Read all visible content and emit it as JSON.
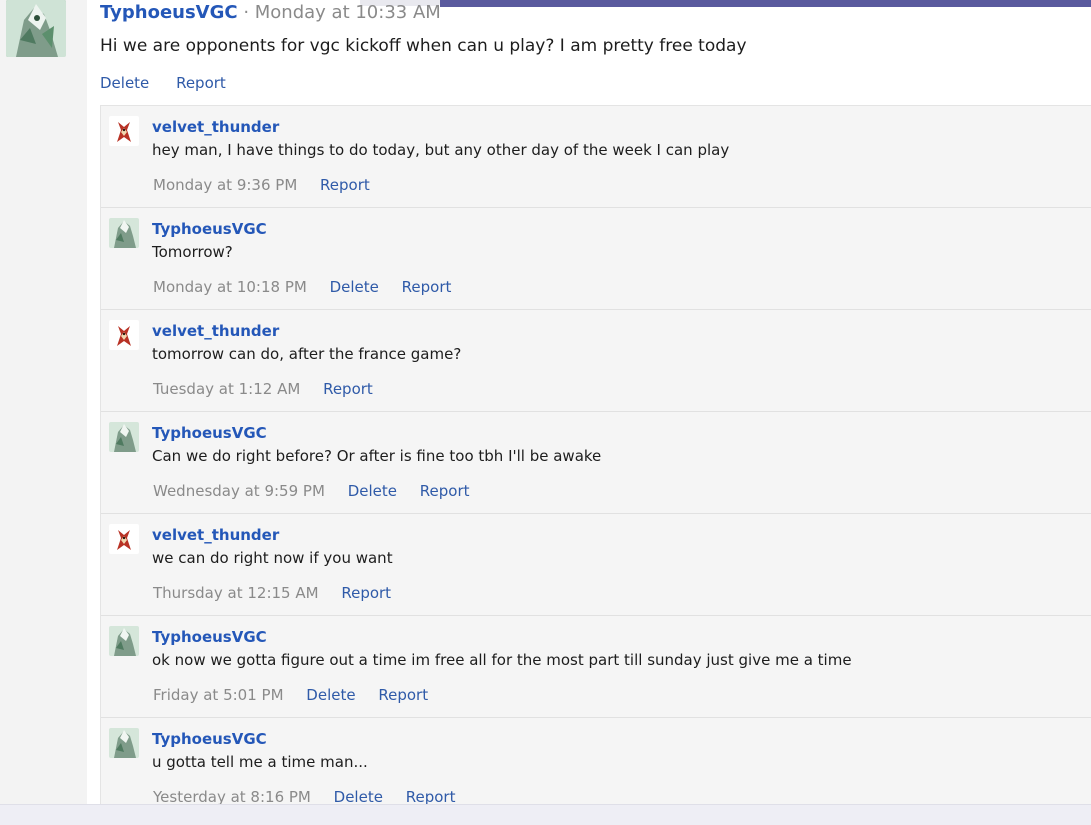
{
  "root_post": {
    "username": "TyphoeusVGC",
    "separator": " · ",
    "timestamp": "Monday at 10:33 AM",
    "message": "Hi we are opponents for vgc kickoff when can u play? I am pretty free today",
    "actions": {
      "delete": "Delete",
      "report": "Report"
    }
  },
  "replies": [
    {
      "username": "velvet_thunder",
      "avatar": "red-creature-avatar",
      "text": "hey man, I have things to do today, but any other day of the week I can play",
      "time": "Monday at 9:36 PM",
      "delete": "",
      "report": "Report"
    },
    {
      "username": "TyphoeusVGC",
      "avatar": "green-creature-avatar",
      "text": "Tomorrow?",
      "time": "Monday at 10:18 PM",
      "delete": "Delete",
      "report": "Report"
    },
    {
      "username": "velvet_thunder",
      "avatar": "red-creature-avatar",
      "text": "tomorrow can do, after the france game?",
      "time": "Tuesday at 1:12 AM",
      "delete": "",
      "report": "Report"
    },
    {
      "username": "TyphoeusVGC",
      "avatar": "green-creature-avatar",
      "text": "Can we do right before? Or after is fine too tbh I'll be awake",
      "time": "Wednesday at 9:59 PM",
      "delete": "Delete",
      "report": "Report"
    },
    {
      "username": "velvet_thunder",
      "avatar": "red-creature-avatar",
      "text": "we can do right now if you want",
      "time": "Thursday at 12:15 AM",
      "delete": "",
      "report": "Report"
    },
    {
      "username": "TyphoeusVGC",
      "avatar": "green-creature-avatar",
      "text": "ok now we gotta figure out a time im free all for the most part till sunday just give me a time",
      "time": "Friday at 5:01 PM",
      "delete": "Delete",
      "report": "Report"
    },
    {
      "username": "TyphoeusVGC",
      "avatar": "green-creature-avatar",
      "text": "u gotta tell me a time man...",
      "time": "Yesterday at 8:16 PM",
      "delete": "Delete",
      "report": "Report"
    }
  ],
  "colors": {
    "link": "#2f5aa8",
    "username": "#2457b8",
    "meta": "#8a8a8a",
    "reply_bg": "#f5f5f5",
    "accent": "#5a5a9e"
  }
}
